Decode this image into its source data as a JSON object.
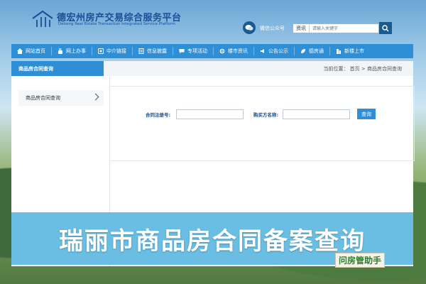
{
  "header": {
    "logo_cn": "德宏州房产交易综合服务平台",
    "logo_en": "Dehong Real Estate Transaction Integrated Service Platform",
    "wechat_label": "微信公众号",
    "search": {
      "category": "资讯",
      "placeholder": "请输入关键字"
    }
  },
  "nav": {
    "items": [
      {
        "label": "网站首页",
        "icon": "home-icon"
      },
      {
        "label": "网上办事",
        "icon": "hand-icon"
      },
      {
        "label": "中介链接",
        "icon": "link-icon"
      },
      {
        "label": "信息披露",
        "icon": "doc-icon"
      },
      {
        "label": "专项活动",
        "icon": "chat-icon"
      },
      {
        "label": "楼市资讯",
        "icon": "gear-icon"
      },
      {
        "label": "公告公示",
        "icon": "announce-icon"
      },
      {
        "label": "德房通",
        "icon": "leaf-icon"
      },
      {
        "label": "新楼上市",
        "icon": "building-icon"
      }
    ]
  },
  "page": {
    "section_title": "商品房合同查询",
    "breadcrumb": "当前位置： 首页 > 商品房合同查询"
  },
  "sidebar": {
    "items": [
      {
        "label": "商品房合同查询"
      }
    ]
  },
  "form": {
    "contract_label": "合同注册号:",
    "buyer_label": "购买方名称:",
    "contract_value": "",
    "buyer_value": "",
    "query_button": "查询"
  },
  "banner": {
    "text": "瑞丽市商品房合同备案查询"
  },
  "watermark": {
    "text": "问房管助手"
  },
  "colors": {
    "primary": "#2f8fd6",
    "banner": "#5fb9e1",
    "brand": "#1a4f96"
  }
}
